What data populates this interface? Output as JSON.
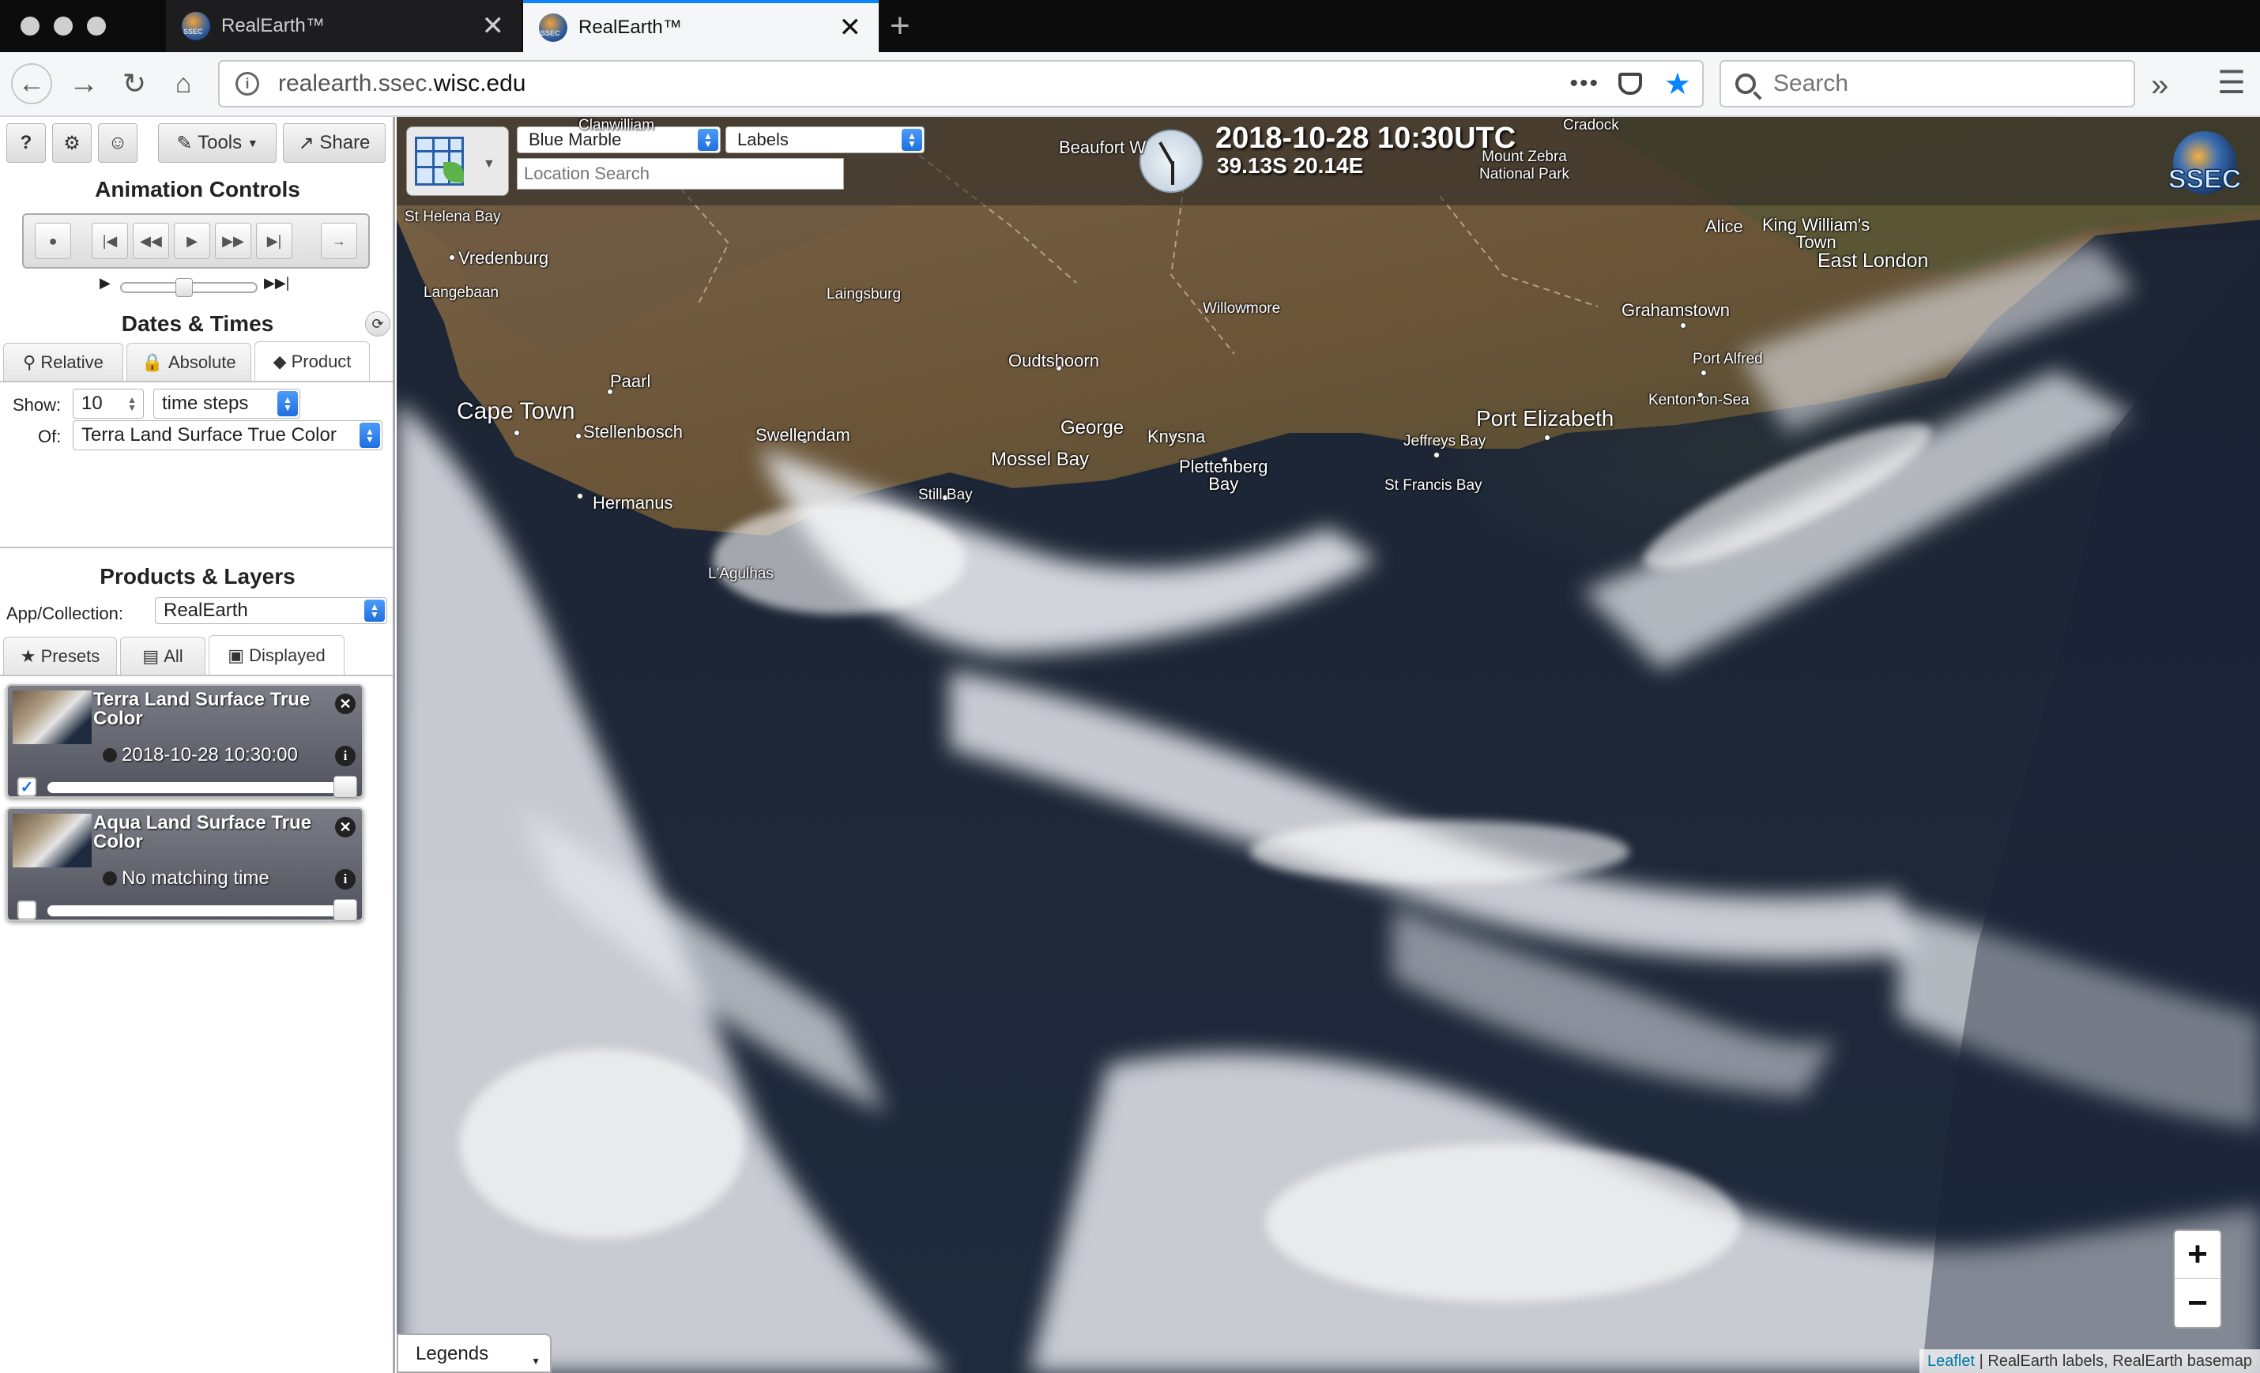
{
  "browser": {
    "tabs": [
      {
        "title": "RealEarth™",
        "active": false
      },
      {
        "title": "RealEarth™",
        "active": true
      }
    ],
    "url_prefix": "realearth.ssec.",
    "url_domain": "wisc.edu",
    "search_placeholder": "Search"
  },
  "toolbar": {
    "help": "?",
    "tools": "Tools",
    "share": "Share"
  },
  "animation": {
    "title": "Animation Controls"
  },
  "dates": {
    "title": "Dates & Times",
    "tabs": [
      "Relative",
      "Absolute",
      "Product"
    ],
    "active_tab": "Product",
    "show_label": "Show:",
    "show_value": "10",
    "unit": "time steps",
    "of_label": "Of:",
    "of_value": "Terra Land Surface True Color"
  },
  "products": {
    "title": "Products & Layers",
    "collection_label": "App/Collection:",
    "collection_value": "RealEarth",
    "tabs": [
      "Presets",
      "All",
      "Displayed"
    ],
    "active_tab": "Displayed",
    "layers": [
      {
        "name": "Terra Land Surface True Color",
        "time": "2018-10-28 10:30:00",
        "checked": true,
        "opacity": 1.0
      },
      {
        "name": "Aqua Land Surface True Color",
        "time": "No matching time",
        "checked": false,
        "opacity": 1.0
      }
    ]
  },
  "map": {
    "basemap": "Blue Marble",
    "overlay": "Labels",
    "location_placeholder": "Location Search",
    "datetime": "2018-10-28 10:30UTC",
    "coordinates": "39.13S 20.14E",
    "logo": "SSEC",
    "zoom_in": "+",
    "zoom_out": "−",
    "legends": "Legends",
    "attribution_link": "Leaflet",
    "attribution_text": " | RealEarth labels, RealEarth basemap",
    "places": [
      {
        "id": "clanwilliam",
        "name": "Clanwilliam"
      },
      {
        "id": "beaufort",
        "name": "Beaufort W"
      },
      {
        "id": "cradock",
        "name": "Cradock"
      },
      {
        "id": "mountzebra",
        "name": "Mount Zebra\nNational Park"
      },
      {
        "id": "sthelena",
        "name": "St Helena Bay"
      },
      {
        "id": "vredenburg",
        "name": "Vredenburg"
      },
      {
        "id": "langebaan",
        "name": "Langebaan"
      },
      {
        "id": "laingsburg",
        "name": "Laingsburg"
      },
      {
        "id": "willowmore",
        "name": "Willowmore"
      },
      {
        "id": "alice",
        "name": "Alice"
      },
      {
        "id": "kingwilliams",
        "name": "King William's\nTown"
      },
      {
        "id": "eastlondon",
        "name": "East London"
      },
      {
        "id": "grahamstown",
        "name": "Grahamstown"
      },
      {
        "id": "oudtshoorn",
        "name": "Oudtshoorn"
      },
      {
        "id": "portalfred",
        "name": "Port Alfred"
      },
      {
        "id": "paarl",
        "name": "Paarl"
      },
      {
        "id": "kenton",
        "name": "Kenton-on-Sea"
      },
      {
        "id": "capetown",
        "name": "Cape Town"
      },
      {
        "id": "stellenbosch",
        "name": "Stellenbosch"
      },
      {
        "id": "swellendam",
        "name": "Swellendam"
      },
      {
        "id": "george",
        "name": "George"
      },
      {
        "id": "knysna",
        "name": "Knysna"
      },
      {
        "id": "portelizabeth",
        "name": "Port Elizabeth"
      },
      {
        "id": "jeffreys",
        "name": "Jeffreys Bay"
      },
      {
        "id": "mossel",
        "name": "Mossel Bay"
      },
      {
        "id": "plettenberg",
        "name": "Plettenberg\nBay"
      },
      {
        "id": "stfrancis",
        "name": "St Francis Bay"
      },
      {
        "id": "hermanus",
        "name": "Hermanus"
      },
      {
        "id": "stillbay",
        "name": "Still Bay"
      },
      {
        "id": "agulhas",
        "name": "L'Agulhas"
      }
    ]
  }
}
